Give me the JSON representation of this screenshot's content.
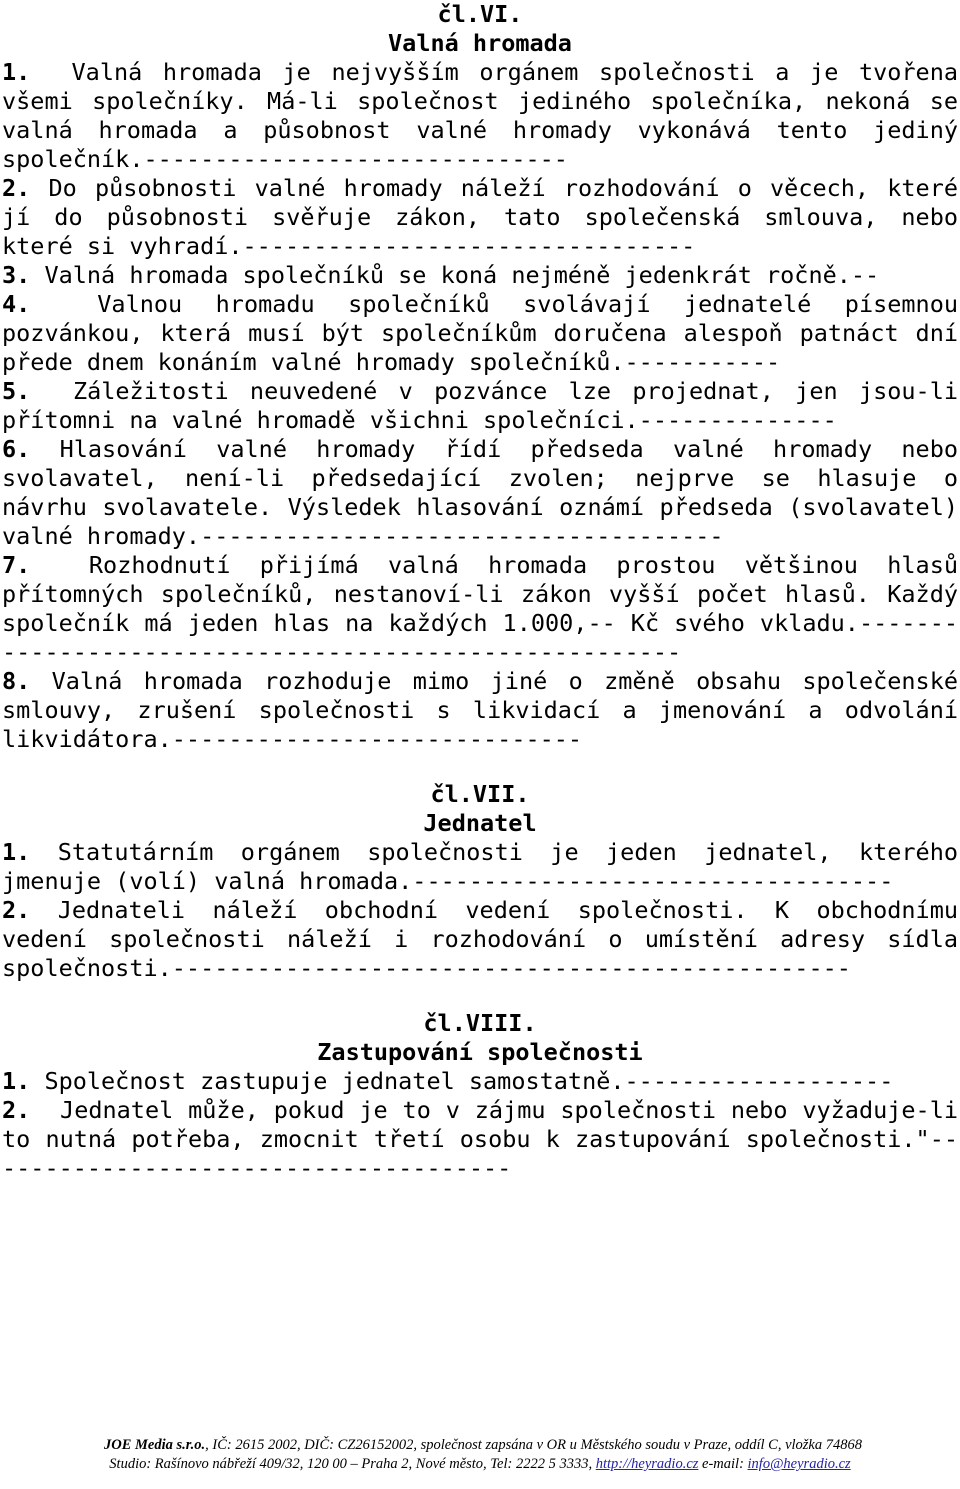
{
  "document": {
    "language": "cs",
    "sections": [
      {
        "article_number": "čl.VI.",
        "article_title": "Valná hromada",
        "paragraphs": [
          {
            "num": "1.",
            "text": "  Valná hromada je nejvyšším orgánem společnosti a je tvořena všemi společníky. Má-li společnost jediného společníka, nekoná se valná hromada a působnost valné hromady vykonává tento jediný společník.------------------------------"
          },
          {
            "num": "2.",
            "text": " Do působnosti valné hromady náleží rozhodování o věcech, které jí do působnosti svěřuje zákon, tato společenská smlouva, nebo které si vyhradí.--------------------------------"
          },
          {
            "num": "3.",
            "text": " Valná hromada společníků se koná nejméně jedenkrát ročně.--"
          },
          {
            "num": "4.",
            "text": "  Valnou hromadu společníků svolávají jednatelé písemnou pozvánkou, která musí být společníkům doručena alespoň patnáct dní přede dnem konáním valné hromady společníků.-----------"
          },
          {
            "num": "5.",
            "text": "  Záležitosti neuvedené v pozvánce lze projednat, jen jsou-li přítomni na valné hromadě všichni společníci.--------------"
          },
          {
            "num": "6.",
            "text": " Hlasování valné hromady řídí předseda valné hromady nebo svolavatel, není-li předsedající zvolen; nejprve se hlasuje o návrhu svolavatele. Výsledek hlasování oznámí předseda (svolavatel) valné hromady.-------------------------------------"
          },
          {
            "num": "7.",
            "text": "  Rozhodnutí přijímá valná hromada prostou většinou hlasů přítomných společníků, nestanoví-li zákon vyšší počet hlasů. Každý společník má jeden hlas na každých 1.000,-- Kč svého vkladu.-------------------------------------------------------"
          },
          {
            "num": "8.",
            "text": " Valná hromada rozhoduje mimo jiné o změně obsahu společenské smlouvy, zrušení společnosti s likvidací a jmenování a odvolání likvidátora.-----------------------------"
          }
        ]
      },
      {
        "article_number": "čl.VII.",
        "article_title": "Jednatel",
        "paragraphs": [
          {
            "num": "1.",
            "text": " Statutárním orgánem společnosti je jeden jednatel, kterého jmenuje (volí) valná hromada.----------------------------------"
          },
          {
            "num": "2.",
            "text": " Jednateli náleží obchodní vedení společnosti. K obchodnímu vedení společnosti náleží i rozhodování o umístění adresy sídla společnosti.------------------------------------------------"
          }
        ]
      },
      {
        "article_number": "čl.VIII.",
        "article_title": "Zastupování společnosti",
        "paragraphs": [
          {
            "num": "1.",
            "text": " Společnost zastupuje jednatel samostatně.-------------------"
          },
          {
            "num": "2.",
            "text": "  Jednatel může, pokud je to v zájmu společnosti nebo vyžaduje-li to nutná potřeba, zmocnit třetí osobu k zastupování společnosti.\"--------------------------------------"
          }
        ]
      }
    ]
  },
  "footer": {
    "line1_brand": "JOE Media s.r.o.",
    "line1_rest": ", IČ: 2615 2002, DIČ: CZ26152002, společnost zapsána v OR u Městského soudu v Praze, oddíl C, vložka 74868",
    "line2_prefix": "Studio: Rašínovo nábřeží 409/32, 120 00 – Praha 2, Nové město, Tel: 2222 5 3333, ",
    "line2_url": "http://heyradio.cz",
    "line2_mid": " e-mail: ",
    "line2_email": "info@heyradio.cz",
    "link_color": "#2222aa"
  }
}
